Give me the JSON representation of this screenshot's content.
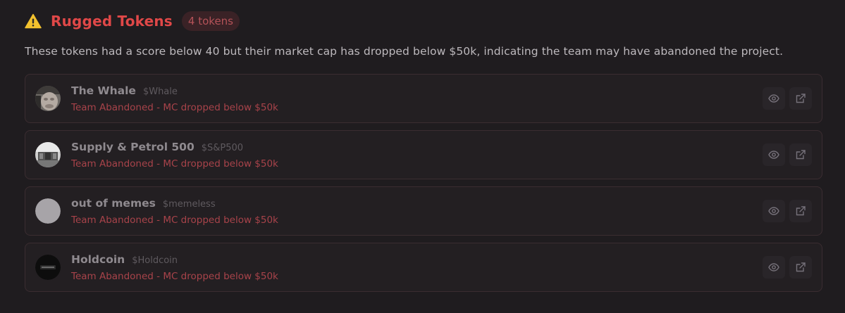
{
  "header": {
    "icon": "warning-icon",
    "title": "Rugged Tokens",
    "count_label": "4 tokens",
    "accent_color": "#e04848"
  },
  "description": "These tokens had a score below 40 but their market cap has dropped below $50k, indicating the team may have abandoned the project.",
  "tokens": [
    {
      "name": "The Whale",
      "symbol": "$Whale",
      "status": "Team Abandoned - MC dropped below $50k",
      "avatar": "whale-avatar"
    },
    {
      "name": "Supply & Petrol 500",
      "symbol": "$S&P500",
      "status": "Team Abandoned - MC dropped below $50k",
      "avatar": "sp500-avatar"
    },
    {
      "name": "out of memes",
      "symbol": "$memeless",
      "status": "Team Abandoned - MC dropped below $50k",
      "avatar": "placeholder-avatar"
    },
    {
      "name": "Holdcoin",
      "symbol": "$Holdcoin",
      "status": "Team Abandoned - MC dropped below $50k",
      "avatar": "holdcoin-avatar"
    }
  ],
  "actions": {
    "view_icon": "eye-icon",
    "open_icon": "external-link-icon"
  }
}
